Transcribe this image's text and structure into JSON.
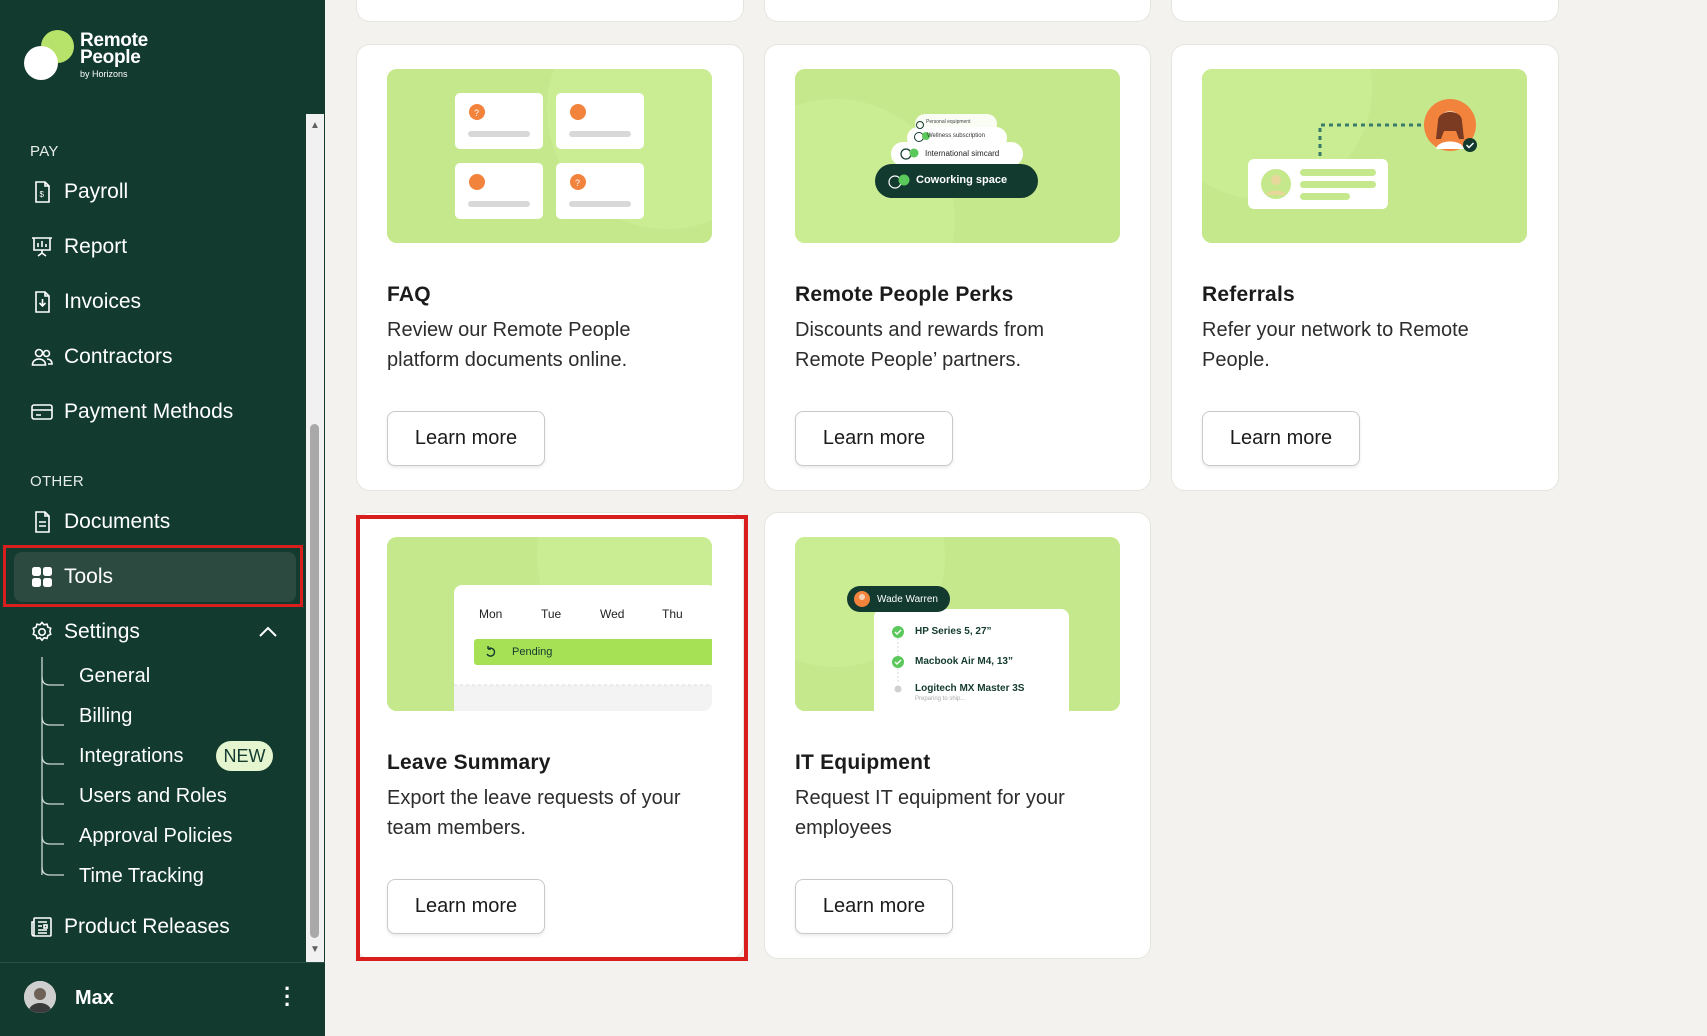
{
  "logo": {
    "line1": "Remote",
    "line2": "People",
    "line3": "by Horizons"
  },
  "sidebar": {
    "pay_label": "PAY",
    "pay_items": [
      {
        "label": "Payroll",
        "icon": "payroll-icon"
      },
      {
        "label": "Report",
        "icon": "report-icon"
      },
      {
        "label": "Invoices",
        "icon": "invoices-icon"
      },
      {
        "label": "Contractors",
        "icon": "contractors-icon"
      },
      {
        "label": "Payment Methods",
        "icon": "payment-methods-icon"
      }
    ],
    "other_label": "OTHER",
    "documents": "Documents",
    "tools": "Tools",
    "settings": "Settings",
    "settings_sub": [
      "General",
      "Billing",
      "Integrations",
      "Users and Roles",
      "Approval Policies",
      "Time Tracking"
    ],
    "new_badge": "NEW",
    "product_releases": "Product Releases"
  },
  "user": {
    "name": "Max"
  },
  "cards": [
    {
      "title": "FAQ",
      "desc": "Review our Remote People platform documents online.",
      "button": "Learn more"
    },
    {
      "title": "Remote People Perks",
      "desc": "Discounts and rewards from Remote People’ partners.",
      "button": "Learn more"
    },
    {
      "title": "Referrals",
      "desc": "Refer your network to Remote People.",
      "button": "Learn more"
    },
    {
      "title": "Leave Summary",
      "desc": "Export the leave requests of your team members.",
      "button": "Learn more"
    },
    {
      "title": "IT Equipment",
      "desc": "Request IT equipment for your employees",
      "button": "Learn more"
    }
  ],
  "perks_illus": {
    "p1": "Personal equipment",
    "p2": "Wellness subscription",
    "p3": "International simcard",
    "p4": "Coworking space"
  },
  "leave_illus": {
    "days": [
      "Mon",
      "Tue",
      "Wed",
      "Thu"
    ],
    "status": "Pending"
  },
  "it_illus": {
    "person": "Wade Warren",
    "items": [
      "HP Series 5, 27”",
      "Macbook Air M4, 13”",
      "Logitech MX Master 3S"
    ],
    "sub": "Preparing to ship..."
  },
  "colors": {
    "sidebar": "#123a2e",
    "accent": "#b8e36a",
    "highlight": "#d91e1e",
    "illus_bg": "#c5e88d"
  }
}
